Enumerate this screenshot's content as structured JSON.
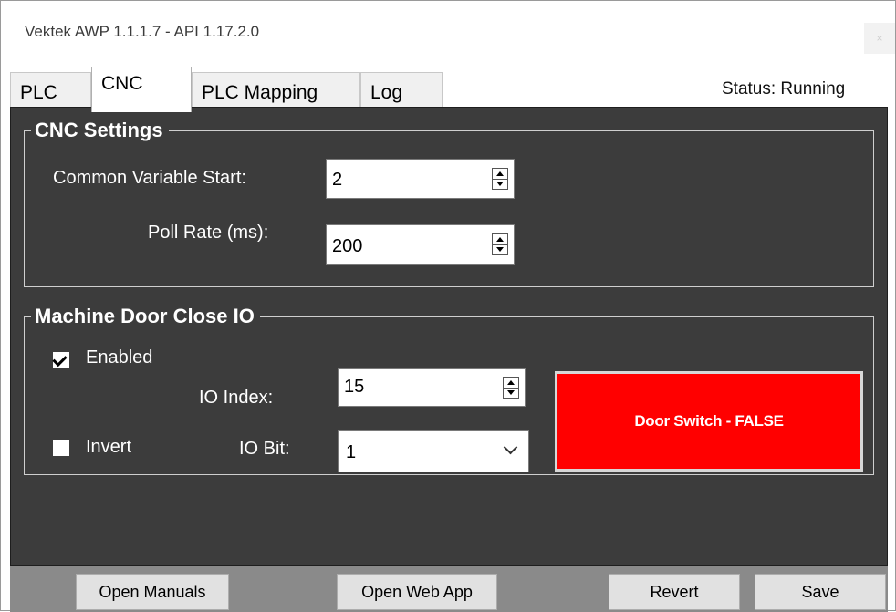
{
  "window": {
    "title": "Vektek AWP 1.1.1.7 - API 1.17.2.0",
    "close_glyph": "×"
  },
  "tabs": [
    {
      "label": "PLC",
      "active": false
    },
    {
      "label": "CNC",
      "active": true
    },
    {
      "label": "PLC Mapping",
      "active": false
    },
    {
      "label": "Log",
      "active": false
    }
  ],
  "status": "Status: Running",
  "cnc_settings": {
    "title": "CNC Settings",
    "common_variable_start": {
      "label": "Common Variable Start:",
      "value": "2"
    },
    "poll_rate": {
      "label": "Poll Rate (ms):",
      "value": "200"
    }
  },
  "door_io": {
    "title": "Machine Door Close IO",
    "enabled": {
      "label": "Enabled",
      "checked": true
    },
    "invert": {
      "label": "Invert",
      "checked": false
    },
    "io_index": {
      "label": "IO Index:",
      "value": "15"
    },
    "io_bit": {
      "label": "IO Bit:",
      "value": "1"
    },
    "door_switch": {
      "label": "Door Switch - FALSE",
      "color": "#ff0000"
    }
  },
  "buttons": {
    "open_manuals": "Open Manuals",
    "open_web_app": "Open Web App",
    "revert": "Revert",
    "save": "Save"
  },
  "icons": {
    "spin_up": "triangle-up-icon",
    "spin_down": "triangle-down-icon",
    "dropdown": "chevron-down-icon",
    "check": "checkmark-icon",
    "close": "close-icon"
  },
  "colors": {
    "panel_bg": "#3c3c3c",
    "bottom_bar": "#8a8a8a",
    "door_false": "#ff0000"
  }
}
